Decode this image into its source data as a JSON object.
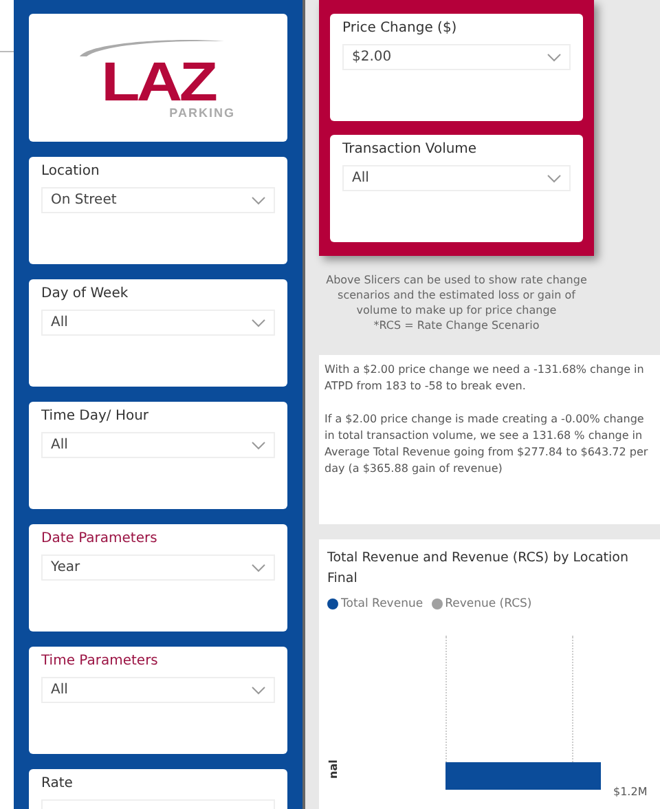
{
  "logo": {
    "text": "LAZ",
    "subtext": "PARKING"
  },
  "filters": [
    {
      "title": "Location",
      "value": "On Street",
      "accent": false
    },
    {
      "title": "Day of Week",
      "value": "All",
      "accent": false
    },
    {
      "title": "Time Day/ Hour",
      "value": "All",
      "accent": false
    },
    {
      "title": "Date Parameters",
      "value": "Year",
      "accent": true
    },
    {
      "title": "Time Parameters",
      "value": "All",
      "accent": true
    },
    {
      "title": "Rate",
      "accent": false
    }
  ],
  "scenario_slicers": [
    {
      "title": "Price Change ($)",
      "value": "$2.00"
    },
    {
      "title": "Transaction Volume",
      "value": "All"
    }
  ],
  "note": [
    "Above Slicers can be used to show rate change scenarios and the estimated loss or gain of volume to make up for price change",
    "*RCS = Rate Change Scenario"
  ],
  "summary": [
    "With a $2.00 price change we need a -131.68% change in ATPD from 183 to -58 to break even.",
    "If a $2.00 price change is made creating a -0.00% change in total transaction volume, we see a 131.68 % change in Average Total Revenue going from $277.84 to $643.72 per day (a $365.88 gain of revenue)"
  ],
  "chart": {
    "title": "Total Revenue and Revenue (RCS) by Location Final",
    "legend": [
      {
        "label": "Total Revenue",
        "color": "#0b4c9a"
      },
      {
        "label": "Revenue (RCS)",
        "color": "#a0a0a0"
      }
    ],
    "axis_label": "nal",
    "bar_label": "$1.2M"
  }
}
